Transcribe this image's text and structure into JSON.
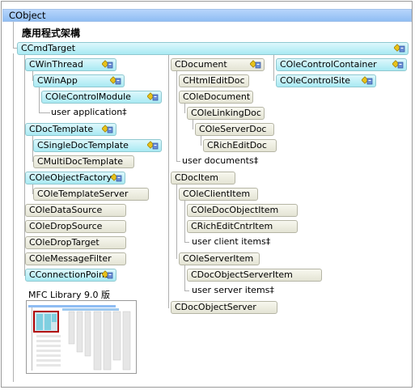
{
  "root": "CObject",
  "subtitle": "應用程式架構",
  "cmd_target": "CCmdTarget",
  "col1": {
    "win_thread": "CWinThread",
    "win_app": "CWinApp",
    "ole_control_module": "COleControlModule",
    "user_application": "user application‡",
    "doc_template": "CDocTemplate",
    "single_doc_template": "CSingleDocTemplate",
    "multi_doc_template": "CMultiDocTemplate",
    "ole_object_factory": "COleObjectFactory",
    "ole_template_server": "COleTemplateServer",
    "ole_data_source": "COleDataSource",
    "ole_drop_source": "COleDropSource",
    "ole_drop_target": "COleDropTarget",
    "ole_message_filter": "COleMessageFilter",
    "connection_point": "CConnectionPoint"
  },
  "col2": {
    "document": "CDocument",
    "html_edit_doc": "CHtmlEditDoc",
    "ole_document": "COleDocument",
    "ole_linking_doc": "COleLinkingDoc",
    "ole_server_doc": "COleServerDoc",
    "rich_edit_doc": "CRichEditDoc",
    "user_documents": "user documents‡",
    "doc_item": "CDocItem",
    "ole_client_item": "COleClientItem",
    "ole_doc_object_item": "COleDocObjectItem",
    "rich_edit_cntr_item": "CRichEditCntrItem",
    "user_client_items": "user client items‡",
    "ole_server_item": "COleServerItem",
    "doc_object_server_item": "CDocObjectServerItem",
    "user_server_items": "user server items‡",
    "doc_object_server": "CDocObjectServer"
  },
  "col3": {
    "ole_control_container": "COleControlContainer",
    "ole_control_site": "COleControlSite"
  },
  "minimap": {
    "caption": "MFC Library 9.0 版"
  },
  "colors": {
    "root_bar": "#a6c9f7",
    "cyan_node": "#c4f1f8",
    "plain_node": "#ecece0",
    "highlight": "#b00000"
  }
}
